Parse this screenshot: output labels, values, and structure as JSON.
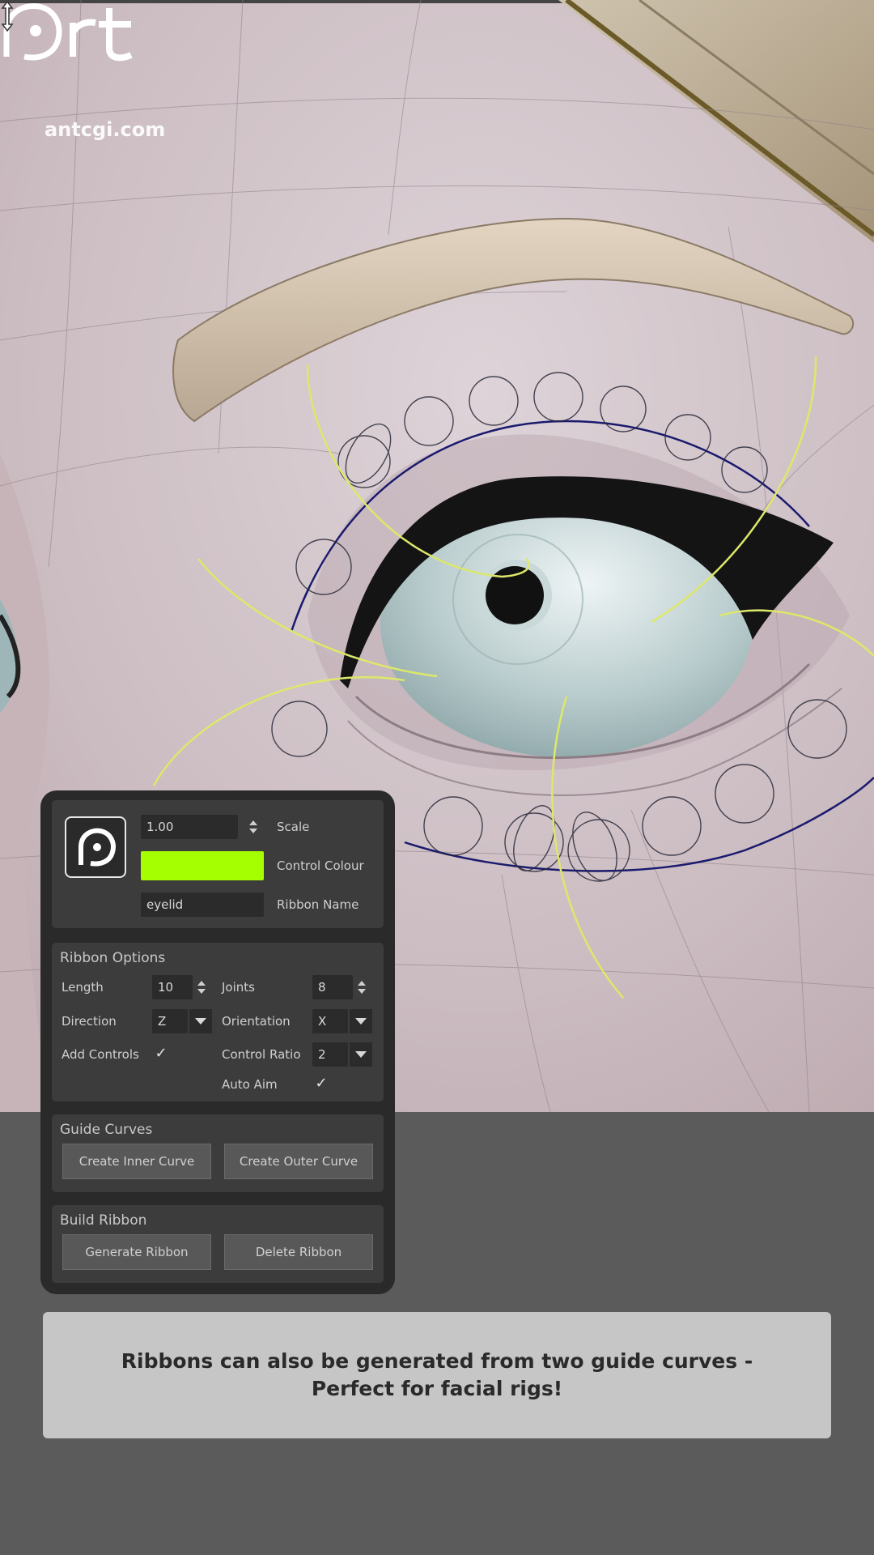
{
  "branding": {
    "logo_text": "Art",
    "site": "antcgi.com"
  },
  "panel": {
    "scale_value": "1.00",
    "scale_label": "Scale",
    "control_colour": "#a6ff00",
    "control_colour_label": "Control Colour",
    "ribbon_name_value": "eyelid",
    "ribbon_name_label": "Ribbon Name"
  },
  "ribbon_options": {
    "title": "Ribbon Options",
    "length_label": "Length",
    "length_value": "10",
    "joints_label": "Joints",
    "joints_value": "8",
    "direction_label": "Direction",
    "direction_value": "Z",
    "orientation_label": "Orientation",
    "orientation_value": "X",
    "add_controls_label": "Add Controls",
    "add_controls_checked": true,
    "control_ratio_label": "Control Ratio",
    "control_ratio_value": "2",
    "auto_aim_label": "Auto Aim",
    "auto_aim_checked": true
  },
  "guide_curves": {
    "title": "Guide Curves",
    "inner_button": "Create Inner Curve",
    "outer_button": "Create Outer Curve"
  },
  "build_ribbon": {
    "title": "Build Ribbon",
    "generate_button": "Generate Ribbon",
    "delete_button": "Delete Ribbon"
  },
  "caption": "Ribbons can also be generated from two guide curves - Perfect for facial rigs!",
  "colors": {
    "accent_green": "#a6ff00",
    "guide_curve": "#dde86a",
    "ribbon_curve": "#1a1a6e"
  }
}
